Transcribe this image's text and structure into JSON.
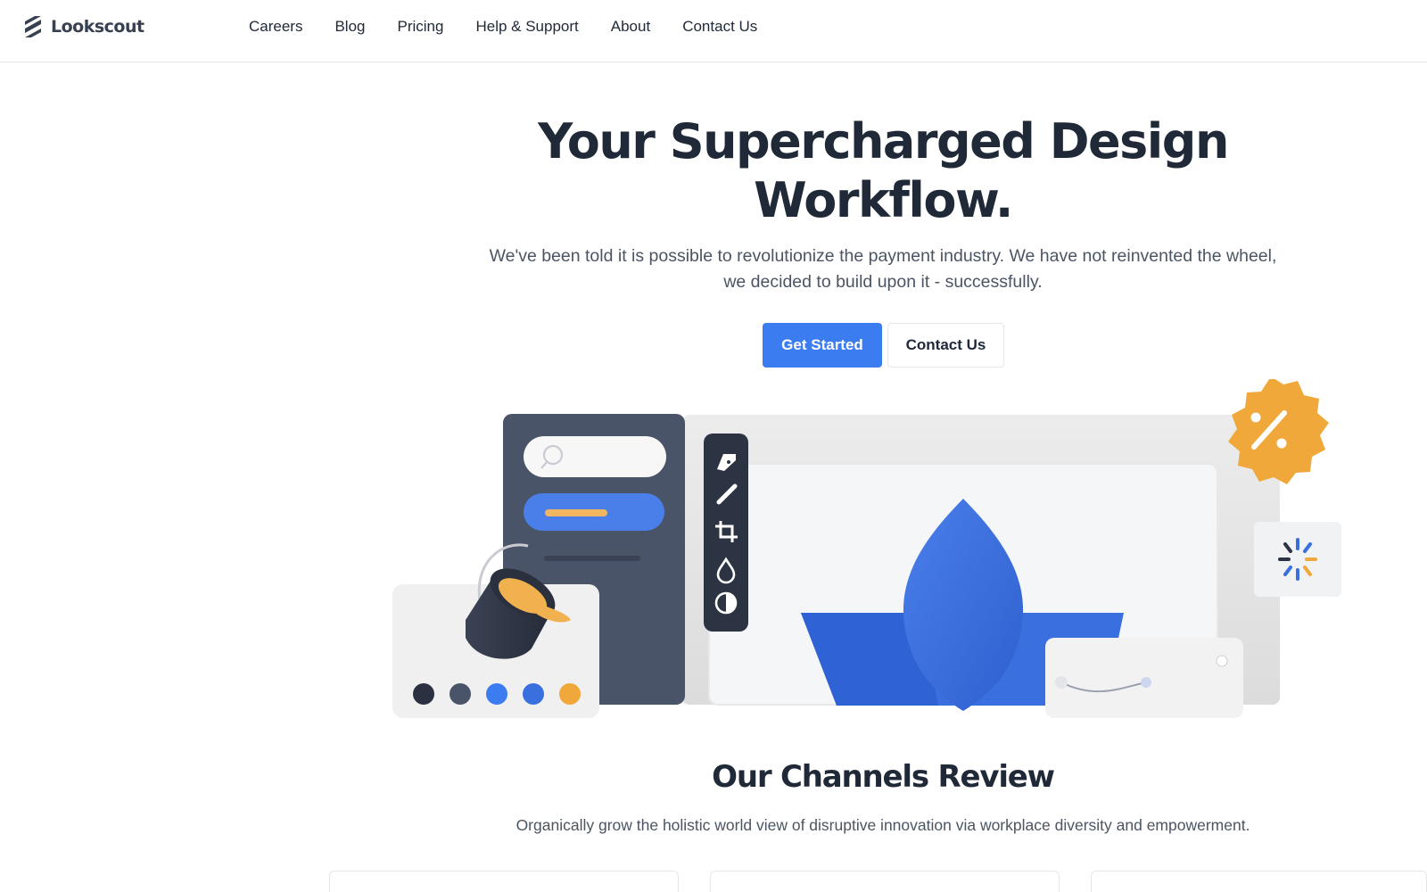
{
  "brand": {
    "name": "Lookscout",
    "icon": "logo-stripes-icon"
  },
  "nav": {
    "items": [
      {
        "label": "Careers"
      },
      {
        "label": "Blog"
      },
      {
        "label": "Pricing"
      },
      {
        "label": "Help & Support"
      },
      {
        "label": "About"
      },
      {
        "label": "Contact Us"
      }
    ]
  },
  "hero": {
    "title_line1": "Your Supercharged Design",
    "title_line2": "Workflow.",
    "subtitle_line1": "We've been told it is possible to revolutionize the payment industry. We have not reinvented the wheel,",
    "subtitle_line2": "we decided to build upon it - successfully.",
    "primary_button": "Get Started",
    "secondary_button": "Contact Us"
  },
  "section": {
    "title": "Our Channels Review",
    "subtitle": "Organically grow the holistic world view of disruptive innovation via workplace diversity and empowerment."
  },
  "colors": {
    "accent": "#3b7cf0",
    "dark_panel": "#4a5468",
    "orange": "#f0a83a",
    "blue_shape": "#3a6fe0",
    "text": "#1f2937",
    "muted": "#4b5563"
  },
  "illustration": {
    "icons": [
      "search-icon",
      "pen-tool-icon",
      "brush-icon",
      "crop-icon",
      "drop-icon",
      "contrast-icon",
      "percent-badge-icon",
      "loading-spinner-icon",
      "paint-bucket-icon"
    ]
  }
}
